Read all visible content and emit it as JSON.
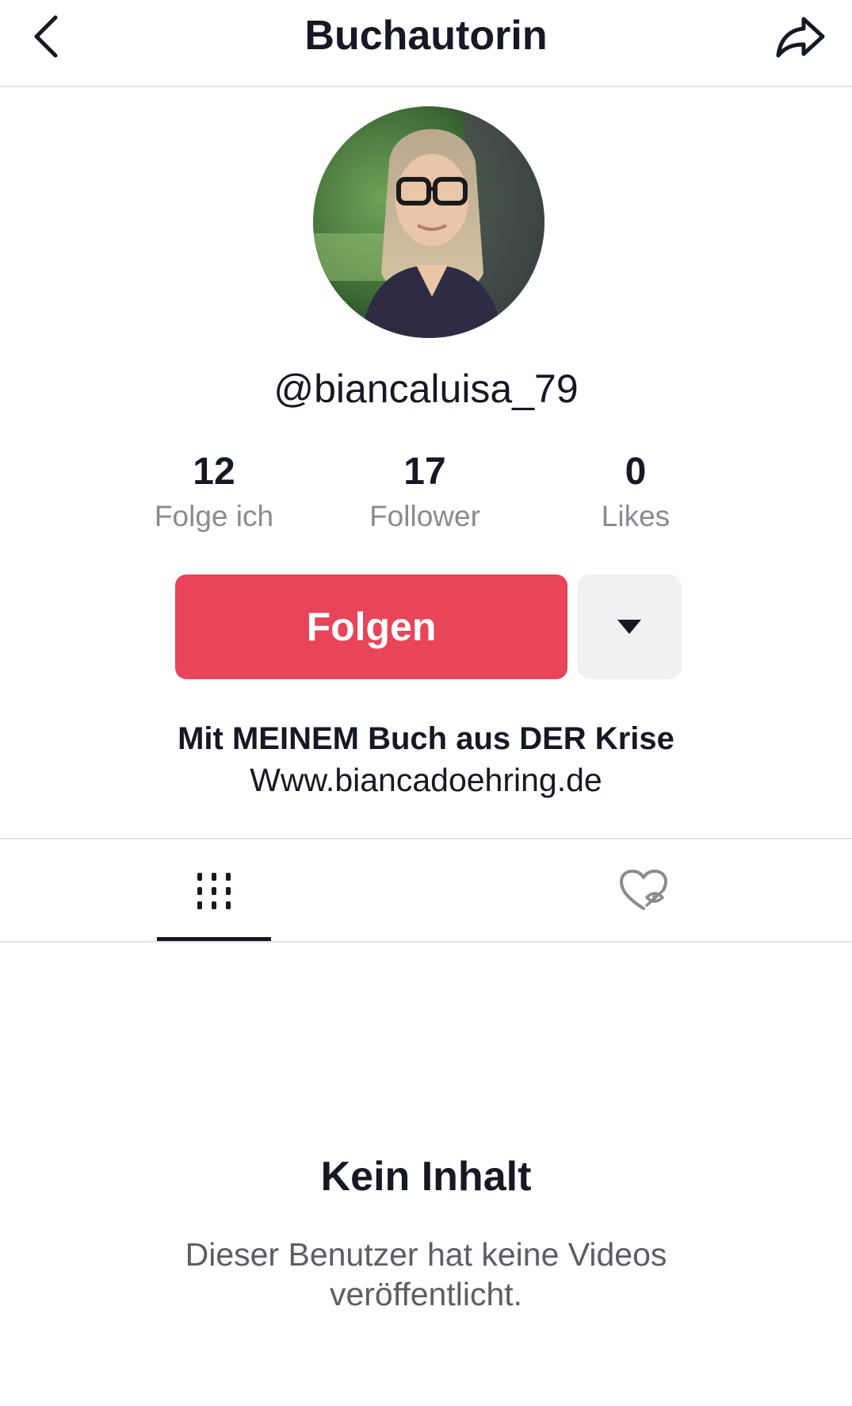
{
  "header": {
    "title": "Buchautorin",
    "back_icon": "chevron-left-icon",
    "share_icon": "share-arrow-icon"
  },
  "profile": {
    "username": "@biancaluisa_79",
    "stats": [
      {
        "value": "12",
        "label": "Folge ich"
      },
      {
        "value": "17",
        "label": "Follower"
      },
      {
        "value": "0",
        "label": "Likes"
      }
    ],
    "follow_label": "Folgen",
    "more_icon": "caret-down-icon",
    "bio_line1": "Mit MEINEM Buch aus DER Krise",
    "bio_line2": "Www.biancadoehring.de"
  },
  "tabs": {
    "videos_icon": "grid-icon",
    "liked_icon": "hidden-heart-icon"
  },
  "empty_state": {
    "title": "Kein Inhalt",
    "description": "Dieser Benutzer hat keine Videos veröffentlicht."
  },
  "colors": {
    "accent": "#e8445a",
    "text": "#161823",
    "muted": "#8a8b91"
  }
}
